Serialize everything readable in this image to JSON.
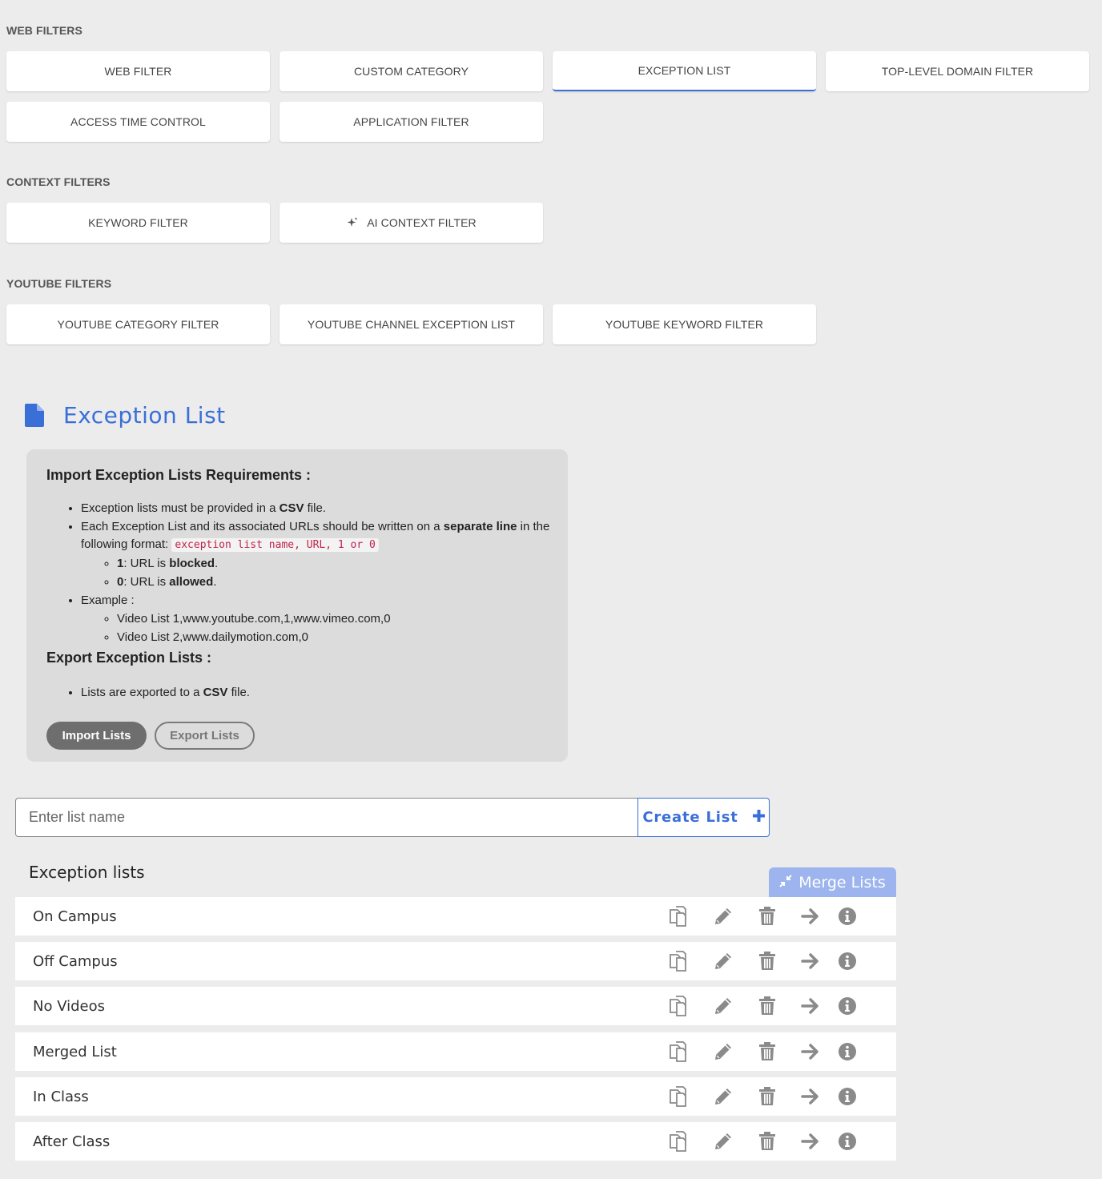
{
  "sections": {
    "web": "WEB FILTERS",
    "context": "CONTEXT FILTERS",
    "youtube": "YOUTUBE FILTERS"
  },
  "tabs": {
    "web_filter": "WEB FILTER",
    "custom_category": "CUSTOM CATEGORY",
    "exception_list": "EXCEPTION LIST",
    "tld_filter": "TOP-LEVEL DOMAIN FILTER",
    "access_time": "ACCESS TIME CONTROL",
    "application_filter": "APPLICATION FILTER",
    "keyword_filter": "KEYWORD FILTER",
    "ai_context_filter": "AI CONTEXT FILTER",
    "youtube_category": "YOUTUBE CATEGORY FILTER",
    "youtube_channel": "YOUTUBE CHANNEL EXCEPTION LIST",
    "youtube_keyword": "YOUTUBE KEYWORD FILTER"
  },
  "active_tab": "exception_list",
  "page_title": "Exception List",
  "info": {
    "import_title": "Import Exception Lists Requirements :",
    "req1_pre": "Exception lists must be provided in a ",
    "req1_bold": "CSV",
    "req1_post": " file.",
    "req2_pre": "Each Exception List and its associated URLs should be written on a ",
    "req2_bold": "separate line",
    "req2_mid": " in the following format: ",
    "req2_code": "exception list name, URL, 1 or 0",
    "blocked_num": "1",
    "blocked_pre": ": URL is ",
    "blocked_bold": "blocked",
    "allowed_num": "0",
    "allowed_pre": ": URL is ",
    "allowed_bold": "allowed",
    "period": ".",
    "example_label": "Example :",
    "example1": "Video List 1,www.youtube.com,1,www.vimeo.com,0",
    "example2": "Video List 2,www.dailymotion.com,0",
    "export_title": "Export Exception Lists :",
    "export_pre": "Lists are exported to a ",
    "export_bold": "CSV",
    "export_post": " file.",
    "import_button": "Import Lists",
    "export_button": "Export Lists"
  },
  "create": {
    "placeholder": "Enter list name",
    "button_label": "Create List"
  },
  "lists_title": "Exception lists",
  "merge_button": "Merge Lists",
  "lists": [
    {
      "name": "On Campus"
    },
    {
      "name": "Off Campus"
    },
    {
      "name": "No Videos"
    },
    {
      "name": "Merged List"
    },
    {
      "name": "In Class"
    },
    {
      "name": "After Class"
    }
  ],
  "colors": {
    "accent": "#3b6fd8",
    "icon_gray": "#8a8a8a",
    "merge_bg": "#9db4ee"
  }
}
